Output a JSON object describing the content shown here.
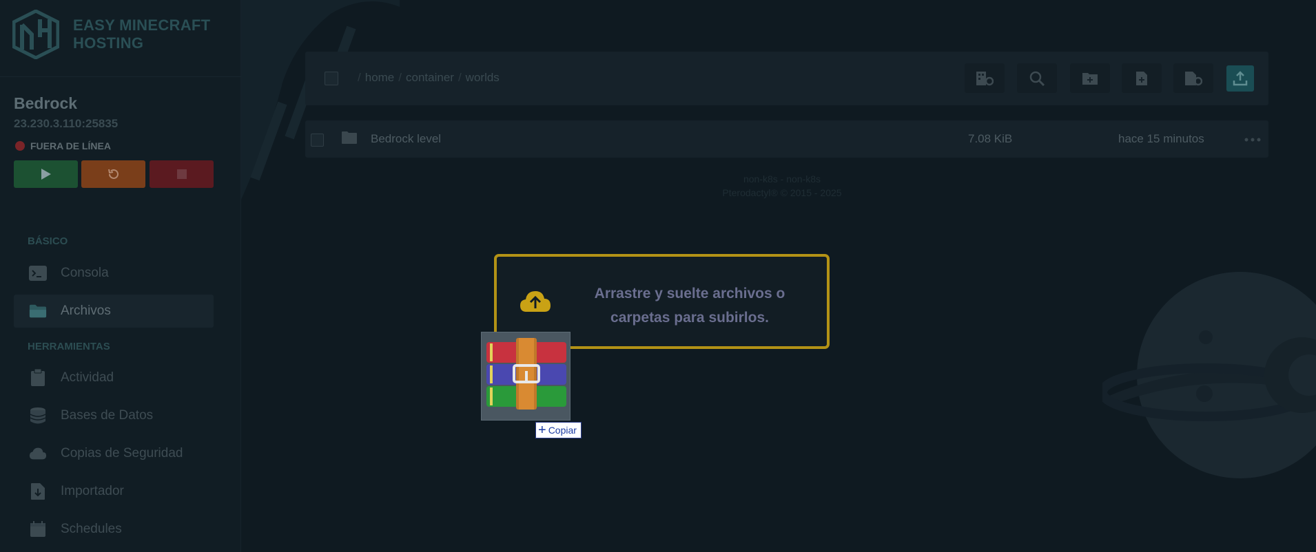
{
  "brand": {
    "line1": "EASY MINECRAFT",
    "line2": "HOSTING"
  },
  "server": {
    "name": "Bedrock",
    "address": "23.230.3.110:25835",
    "status": "FUERA DE LÍNEA"
  },
  "power": {
    "start_icon": "play-icon",
    "restart_icon": "restart-icon",
    "stop_icon": "stop-icon"
  },
  "sidebar": {
    "section_basic": "BÁSICO",
    "section_tools": "HERRAMIENTAS",
    "items": [
      {
        "label": "Consola",
        "icon": "terminal-icon"
      },
      {
        "label": "Archivos",
        "icon": "folder-icon",
        "active": true
      },
      {
        "label": "Actividad",
        "icon": "clipboard-icon"
      },
      {
        "label": "Bases de Datos",
        "icon": "database-icon"
      },
      {
        "label": "Copias de Seguridad",
        "icon": "cloud-icon"
      },
      {
        "label": "Importador",
        "icon": "file-import-icon"
      },
      {
        "label": "Schedules",
        "icon": "calendar-icon"
      }
    ]
  },
  "breadcrumb": {
    "root": "home",
    "sep": "/",
    "parts": [
      "container",
      "worlds"
    ]
  },
  "toolbar": {
    "icons": [
      "server-settings-icon",
      "search-icon",
      "new-folder-icon",
      "new-file-icon",
      "upload-file-icon",
      "upload-icon"
    ]
  },
  "files": [
    {
      "name": "Bedrock level",
      "size": "7.08 KiB",
      "modified": "hace 15 minutos"
    }
  ],
  "footer": {
    "line1": "non-k8s - non-k8s",
    "line2": "Pterodactyl® © 2015 - 2025"
  },
  "dropzone": {
    "line1": "Arrastre y suelte archivos o",
    "line2": "carpetas para subirlos."
  },
  "drag": {
    "tooltip": "Copiar"
  },
  "colors": {
    "accent_yellow": "#b39216",
    "start": "#1c5132",
    "restart": "#7a3e1a",
    "stop": "#5b1a20"
  }
}
